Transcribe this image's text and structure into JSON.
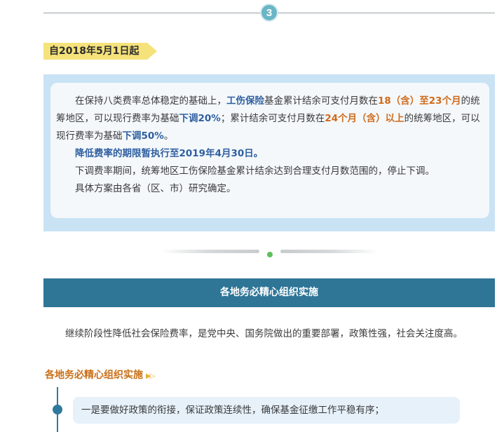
{
  "step": {
    "number": "3"
  },
  "date_tag": {
    "label": "自2018年5月1日起"
  },
  "notice": {
    "p1": {
      "a": "在保持八类费率总体稳定的基础上，",
      "b": "工伤保险",
      "c": "基金累计结余可支付月数在",
      "d": "18（含）至23个月",
      "e": "的统筹地区，可以现行费率为基础",
      "f": "下调20%",
      "g": "；累计结余可支付月数在",
      "h": "24个月（含）以上",
      "i": "的统筹地区，可以现行费率为基础",
      "j": "下调50%",
      "k": "。"
    },
    "p2": "降低费率的期限暂执行至2019年4月30日。",
    "p3": "下调费率期间，统筹地区工伤保险基金累计结余达到合理支付月数范围的，停止下调。",
    "p4": "具体方案由各省（区、市）研究确定。"
  },
  "section": {
    "title": "各地务必精心组织实施"
  },
  "intro": "继续阶段性降低社会保险费率，是党中央、国务院做出的重要部署，政策性强，社会关注度高。",
  "sub_heading": {
    "text": "各地务必精心组织实施"
  },
  "bullets": [
    "一是要做好政策的衔接，保证政策连续性，确保基金征缴工作平稳有序；"
  ],
  "colors": {
    "accent_blue": "#2e7596",
    "highlight_orange": "#d06a1a",
    "highlight_blue": "#2f5fa0",
    "tag_yellow": "#f5e27a"
  }
}
